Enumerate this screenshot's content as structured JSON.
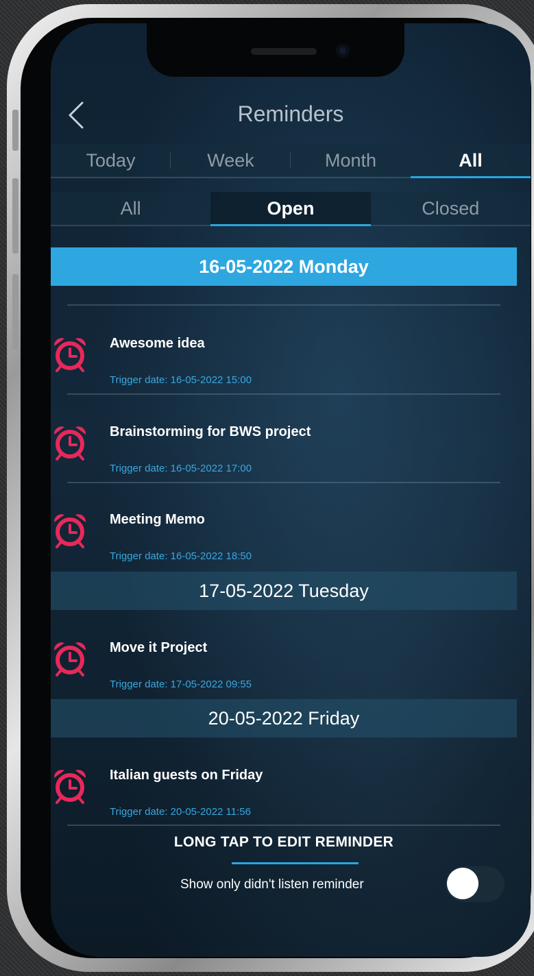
{
  "header": {
    "title": "Reminders"
  },
  "period_tabs": [
    {
      "label": "Today",
      "active": false
    },
    {
      "label": "Week",
      "active": false
    },
    {
      "label": "Month",
      "active": false
    },
    {
      "label": "All",
      "active": true
    }
  ],
  "status_tabs": [
    {
      "label": "All",
      "active": false
    },
    {
      "label": "Open",
      "active": true
    },
    {
      "label": "Closed",
      "active": false
    }
  ],
  "groups": [
    {
      "date": "16-05-2022 Monday",
      "items": [
        {
          "title": "Awesome idea",
          "trigger": "Trigger date: 16-05-2022 15:00"
        },
        {
          "title": "Brainstorming for BWS project",
          "trigger": "Trigger date: 16-05-2022 17:00"
        },
        {
          "title": "Meeting Memo",
          "trigger": "Trigger date: 16-05-2022 18:50"
        }
      ]
    },
    {
      "date": "17-05-2022 Tuesday",
      "items": [
        {
          "title": "Move it Project",
          "trigger": "Trigger date: 17-05-2022 09:55"
        }
      ]
    },
    {
      "date": "20-05-2022 Friday",
      "items": [
        {
          "title": "Italian guests on Friday",
          "trigger": "Trigger date: 20-05-2022 11:56"
        }
      ]
    }
  ],
  "footer": {
    "hint": "LONG TAP TO EDIT REMINDER",
    "toggle_label": "Show only didn't listen reminder",
    "toggle_on": false
  },
  "colors": {
    "accent": "#2ea7e0",
    "alarm_icon": "#e8285a",
    "background": "#13283a"
  },
  "icons": {
    "back": "chevron-left-icon",
    "alarm": "alarm-clock-icon"
  }
}
